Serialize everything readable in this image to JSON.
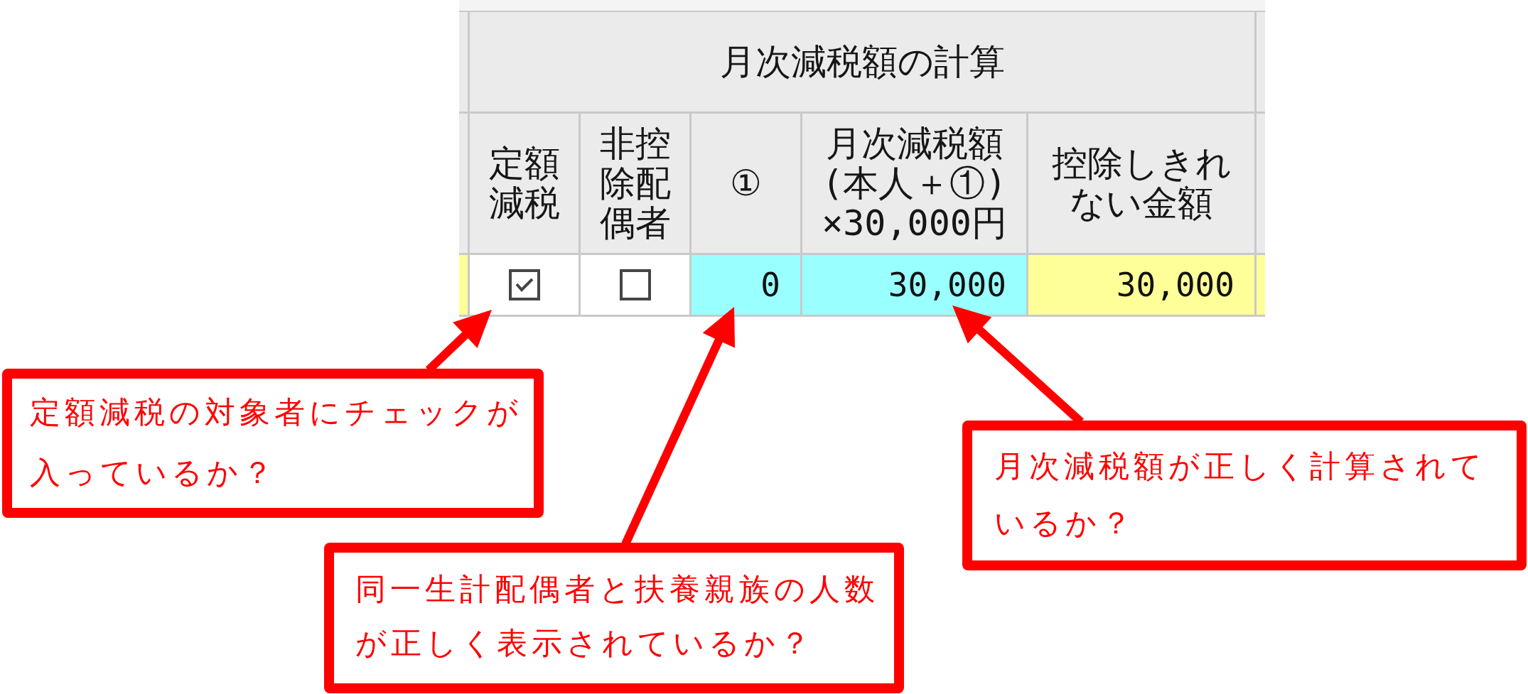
{
  "table": {
    "group_header": "月次減税額の計算",
    "columns": [
      {
        "kind": "edge"
      },
      {
        "kind": "label",
        "label": "定額減税"
      },
      {
        "kind": "label",
        "label": "非控除配偶者"
      },
      {
        "kind": "label",
        "label": "①"
      },
      {
        "kind": "label",
        "label": "月次減税額(本人＋①)×30,000円"
      },
      {
        "kind": "label",
        "label": "控除しきれない金額"
      },
      {
        "kind": "edge"
      }
    ],
    "rows": [
      {
        "cells": [
          {
            "kind": "edge",
            "color": "#ffff99"
          },
          {
            "kind": "checkbox",
            "checked": true,
            "color": "#ffffff"
          },
          {
            "kind": "checkbox",
            "checked": false,
            "color": "#ffffff"
          },
          {
            "kind": "number",
            "value": "0",
            "color": "#99ffff"
          },
          {
            "kind": "number",
            "value": "30,000",
            "color": "#99ffff"
          },
          {
            "kind": "number",
            "value": "30,000",
            "color": "#ffff99"
          },
          {
            "kind": "edge",
            "color": "#ffff99"
          }
        ]
      }
    ]
  },
  "callouts": [
    {
      "text": "定額減税の対象者にチェックが入っているか？"
    },
    {
      "text": "同一生計配偶者と扶養親族の人数が正しく表示されているか？"
    },
    {
      "text": "月次減税額が正しく計算されているか？"
    }
  ]
}
